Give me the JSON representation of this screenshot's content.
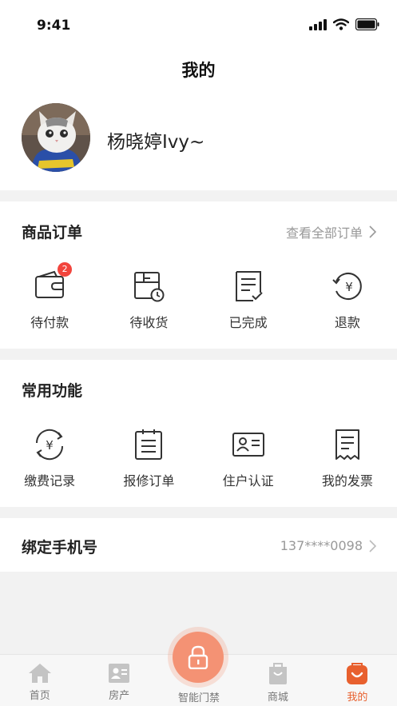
{
  "status_bar": {
    "time": "9:41"
  },
  "header": {
    "title": "我的"
  },
  "profile": {
    "username": "杨晓婷Ivy~"
  },
  "orders": {
    "title": "商品订单",
    "view_all": "查看全部订单",
    "items": [
      {
        "label": "待付款",
        "icon": "wallet-icon",
        "badge": "2"
      },
      {
        "label": "待收货",
        "icon": "box-clock-icon"
      },
      {
        "label": "已完成",
        "icon": "document-check-icon"
      },
      {
        "label": "退款",
        "icon": "refund-icon"
      }
    ]
  },
  "functions": {
    "title": "常用功能",
    "items": [
      {
        "label": "缴费记录",
        "icon": "payment-record-icon"
      },
      {
        "label": "报修订单",
        "icon": "repair-order-icon"
      },
      {
        "label": "住户认证",
        "icon": "id-card-icon"
      },
      {
        "label": "我的发票",
        "icon": "invoice-icon"
      }
    ]
  },
  "phone": {
    "label": "绑定手机号",
    "value": "137****0098"
  },
  "tabbar": {
    "items": [
      {
        "label": "首页",
        "icon": "home-icon"
      },
      {
        "label": "房产",
        "icon": "property-icon"
      },
      {
        "label": "智能门禁",
        "icon": "lock-icon"
      },
      {
        "label": "商城",
        "icon": "shopping-bag-icon"
      },
      {
        "label": "我的",
        "icon": "profile-face-icon"
      }
    ],
    "active": "我的"
  },
  "colors": {
    "accent": "#e8602e",
    "badge": "#f2453d",
    "center_button": "#f49274"
  }
}
